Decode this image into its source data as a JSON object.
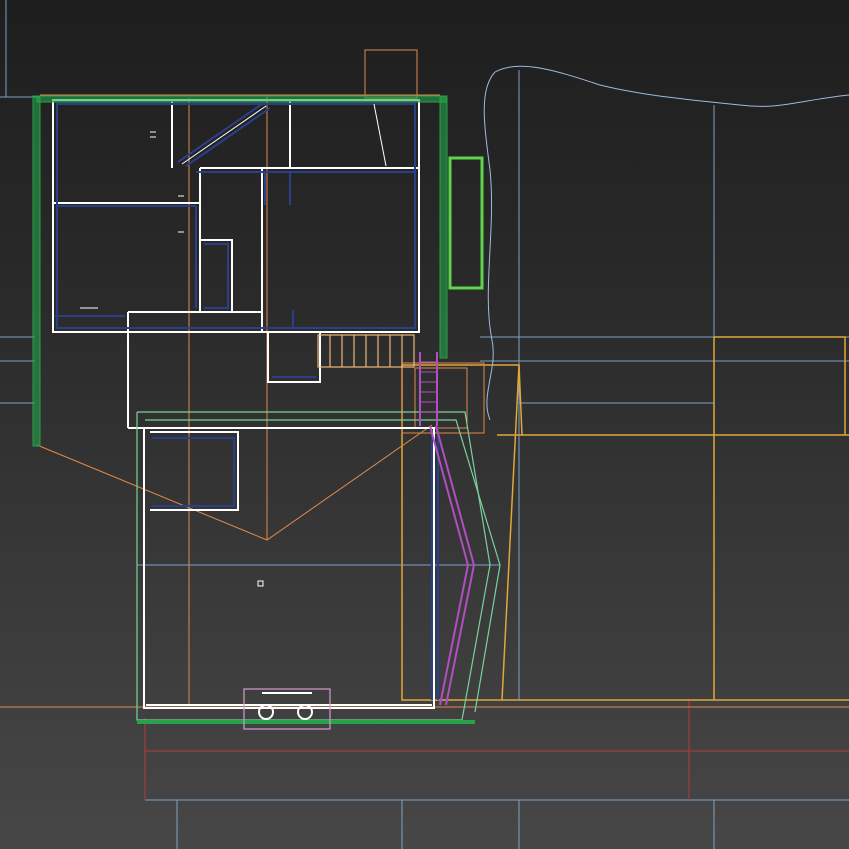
{
  "viewport": {
    "view": "top",
    "grid": true,
    "background_gradient": [
      "#1e1e1e",
      "#474747"
    ]
  },
  "colors": {
    "grid": "#7fa1c8",
    "wall": "#ffffff",
    "wall_inner": "#2a3f8a",
    "roof_outline": "#e0894a",
    "neighbor_building": "#e0a83a",
    "railing": "#27a24a",
    "railing_bright": "#5fd24f",
    "terrace": "#7ad29a",
    "stair": "#e8b87a",
    "ramp": "#b04fbf",
    "site_boundary": "#b8393a",
    "appliance": "#d89ad0",
    "contour": "#9cbbe0"
  }
}
